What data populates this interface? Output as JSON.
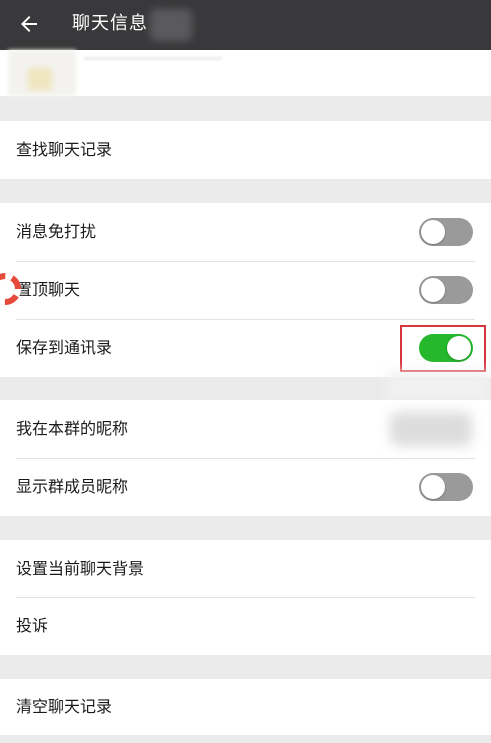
{
  "header": {
    "title": "聊天信息",
    "back_icon": "arrow-left-icon"
  },
  "colors": {
    "header_bg": "#39393b",
    "toggle_on": "#25b82c",
    "toggle_off": "#9a9a9a",
    "highlight": "#d8353c"
  },
  "rows": {
    "find_history": "查找聊天记录",
    "mute": "消息免打扰",
    "pin": "置顶聊天",
    "save_contacts": "保存到通讯录",
    "my_nickname": "我在本群的昵称",
    "show_nicknames": "显示群成员昵称",
    "set_background": "设置当前聊天背景",
    "report": "投诉",
    "clear_history": "清空聊天记录"
  },
  "toggles": {
    "mute": false,
    "pin": false,
    "save_contacts": true,
    "show_nicknames": false
  }
}
